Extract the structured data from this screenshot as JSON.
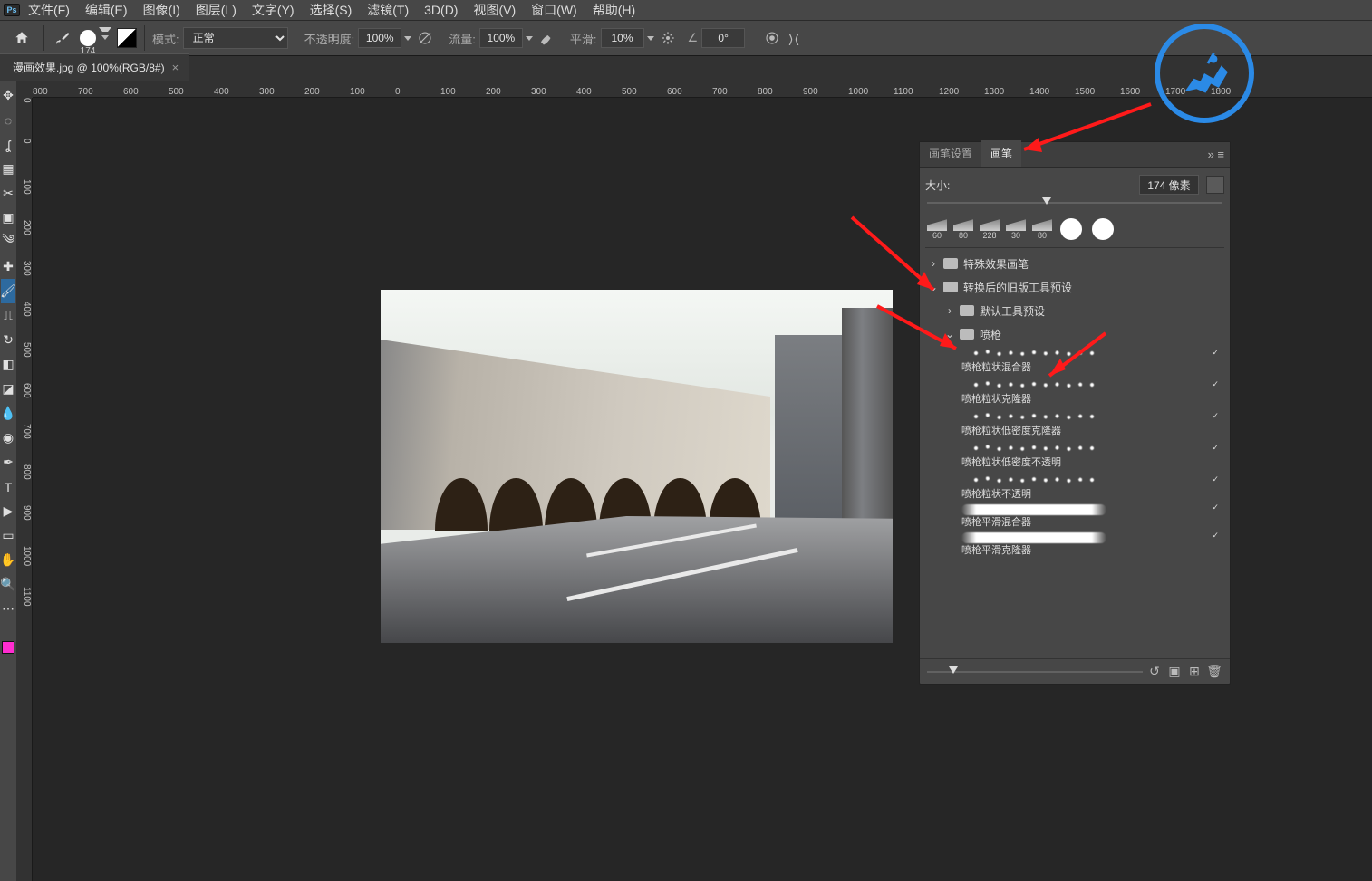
{
  "menubar": {
    "items": [
      "文件(F)",
      "编辑(E)",
      "图像(I)",
      "图层(L)",
      "文字(Y)",
      "选择(S)",
      "滤镜(T)",
      "3D(D)",
      "视图(V)",
      "窗口(W)",
      "帮助(H)"
    ]
  },
  "opt": {
    "brush_size": "174",
    "mode_label": "模式:",
    "mode_value": "正常",
    "opacity_label": "不透明度:",
    "opacity_value": "100%",
    "flow_label": "流量:",
    "flow_value": "100%",
    "smooth_label": "平滑:",
    "smooth_value": "10%",
    "angle_icon": "∠",
    "angle_value": "0°"
  },
  "file_tab": {
    "label": "漫画效果.jpg @ 100%(RGB/8#)"
  },
  "ruler_h": [
    "800",
    "700",
    "600",
    "500",
    "400",
    "300",
    "200",
    "100",
    "0",
    "100",
    "200",
    "300",
    "400",
    "500",
    "600",
    "700",
    "800",
    "900",
    "1000",
    "1100",
    "1200",
    "1300",
    "1400",
    "1500",
    "1600",
    "1700",
    "1800"
  ],
  "ruler_v": [
    "0",
    "0",
    "100",
    "200",
    "300",
    "400",
    "500",
    "600",
    "700",
    "800",
    "900",
    "1000",
    "1100"
  ],
  "panel": {
    "tab1": "画笔设置",
    "tab2": "画笔",
    "size_label": "大小:",
    "size_value": "174 像素",
    "tip_sizes": [
      "60",
      "80",
      "228",
      "30",
      "80"
    ],
    "folders": {
      "special": "特殊效果画笔",
      "legacy": "转换后的旧版工具预设",
      "default": "默认工具预设",
      "airbrush": "喷枪"
    },
    "brushes": [
      "喷枪粒状混合器",
      "喷枪粒状克隆器",
      "喷枪粒状低密度克隆器",
      "喷枪粒状低密度不透明",
      "喷枪粒状不透明",
      "喷枪平滑混合器",
      "喷枪平滑克隆器"
    ]
  },
  "colors": {
    "accent": "#2b8ae6",
    "arrow": "#ff1a1a"
  }
}
